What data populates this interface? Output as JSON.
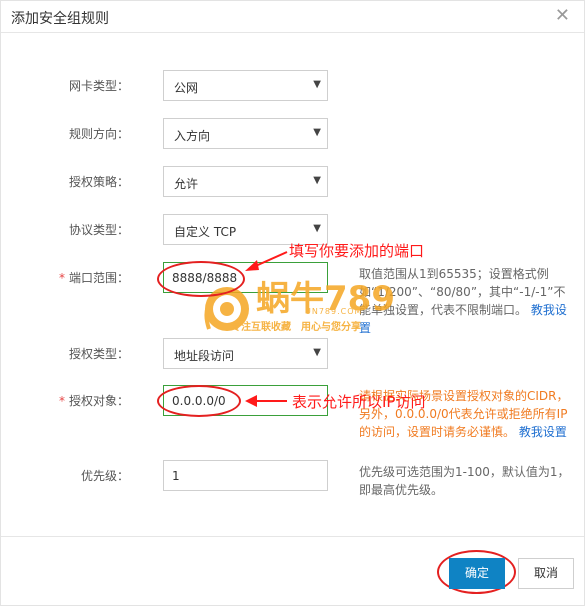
{
  "dialog": {
    "title": "添加安全组规则",
    "close_icon": "close-icon"
  },
  "form": {
    "nic_type": {
      "label": "网卡类型：",
      "value": "公网"
    },
    "direction": {
      "label": "规则方向：",
      "value": "入方向"
    },
    "policy": {
      "label": "授权策略：",
      "value": "允许"
    },
    "protocol": {
      "label": "协议类型：",
      "value": "自定义 TCP"
    },
    "port_range": {
      "required": "*",
      "label": "端口范围：",
      "value": "8888/8888",
      "help": "取值范围从1到65535；设置格式例如“1/200”、“80/80”，其中“-1/-1”不能单独设置，代表不限制端口。",
      "help_link": "教我设置"
    },
    "auth_type": {
      "label": "授权类型：",
      "value": "地址段访问"
    },
    "auth_object": {
      "required": "*",
      "label": "授权对象：",
      "value": "0.0.0.0/0",
      "help": "请根据实际场景设置授权对象的CIDR，另外，0.0.0.0/0代表允许或拒绝所有IP的访问，设置时请务必谨慎。",
      "help_link": "教我设置"
    },
    "priority": {
      "label": "优先级：",
      "value": "1",
      "help": "优先级可选范围为1-100，默认值为1，即最高优先级。"
    }
  },
  "annotations": {
    "port_note": "填写你要添加的端口",
    "ip_note": "表示允许所以IP访问"
  },
  "watermark": {
    "brand": "蜗牛789",
    "url": "UN789.COM",
    "slogan": "专注互联收藏　用心与您分享"
  },
  "footer": {
    "ok_label": "确定",
    "cancel_label": "取消"
  },
  "colors": {
    "primary": "#0f83c4",
    "annotation": "#ff1a1a",
    "link": "#1f6fd0",
    "warning_text": "#f07b21",
    "highlight_border": "#3aa03a"
  }
}
